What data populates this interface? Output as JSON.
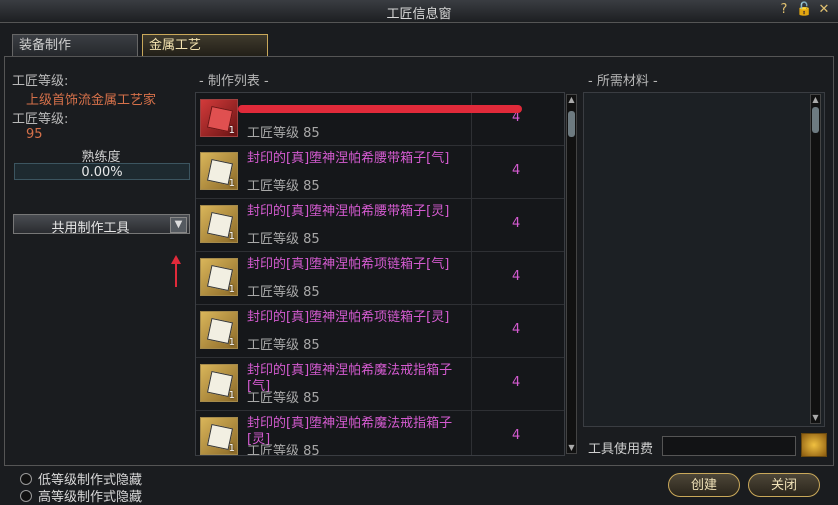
{
  "window": {
    "title": "工匠信息窗",
    "icons": [
      "help-icon",
      "lock-icon",
      "close-icon"
    ],
    "icon_glyphs": [
      "?",
      "🔓",
      "✕"
    ]
  },
  "tabs": [
    {
      "label": "装备制作",
      "active": false
    },
    {
      "label": "金属工艺",
      "active": true
    }
  ],
  "left": {
    "level_label_1": "工匠等级:",
    "level_value_1": "上级首饰流金属工艺家",
    "level_label_2": "工匠等级:",
    "level_value_2": "95",
    "proficiency_label": "熟练度",
    "proficiency_value": "0.00%",
    "proficiency_fraction": 0.0,
    "tool_dropdown": "共用制作工具"
  },
  "craft_list": {
    "title": "- 制作列表 -",
    "items": [
      {
        "name": "",
        "level": "工匠等级 85",
        "count": "4",
        "qty": "1",
        "icon": "red-chest-icon"
      },
      {
        "name": "封印的[真]堕神涅帕希腰带箱子[气]",
        "level": "工匠等级 85",
        "count": "4",
        "qty": "1",
        "icon": "sealed-box-icon"
      },
      {
        "name": "封印的[真]堕神涅帕希腰带箱子[灵]",
        "level": "工匠等级 85",
        "count": "4",
        "qty": "1",
        "icon": "sealed-box-icon"
      },
      {
        "name": "封印的[真]堕神涅帕希项链箱子[气]",
        "level": "工匠等级 85",
        "count": "4",
        "qty": "1",
        "icon": "sealed-box-icon"
      },
      {
        "name": "封印的[真]堕神涅帕希项链箱子[灵]",
        "level": "工匠等级 85",
        "count": "4",
        "qty": "1",
        "icon": "sealed-box-icon"
      },
      {
        "name": "封印的[真]堕神涅帕希魔法戒指箱子[气]",
        "level": "工匠等级 85",
        "count": "4",
        "qty": "1",
        "icon": "sealed-box-icon"
      },
      {
        "name": "封印的[真]堕神涅帕希魔法戒指箱子[灵]",
        "level": "工匠等级 85",
        "count": "4",
        "qty": "1",
        "icon": "sealed-box-icon"
      }
    ]
  },
  "materials": {
    "title": "- 所需材料 -"
  },
  "fee": {
    "label": "工具使用费",
    "value": ""
  },
  "options": [
    {
      "label": "低等级制作式隐藏"
    },
    {
      "label": "高等级制作式隐藏"
    }
  ],
  "buttons": {
    "create": "创建",
    "close": "关闭"
  },
  "colors": {
    "item_name": "#d45bd0",
    "level_value": "#d6714a",
    "accent": "#c9a85a",
    "annotation_red": "#e02a3a"
  }
}
